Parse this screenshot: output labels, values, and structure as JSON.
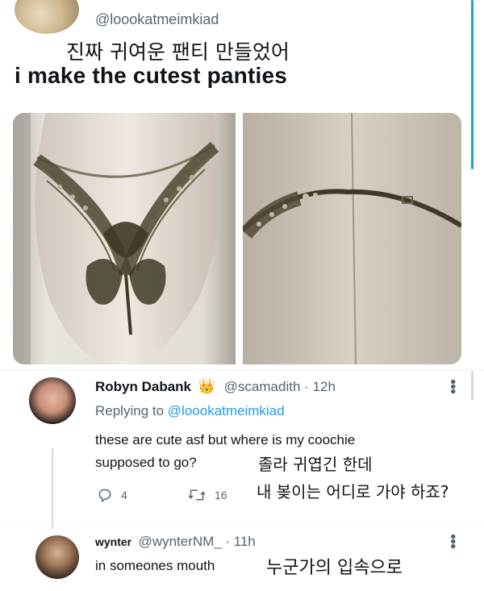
{
  "tweet": {
    "handle": "@loookatmeimkiad",
    "text_korean": "진짜 귀여운 팬티 만들었어",
    "text_english": "i make the cutest panties"
  },
  "reply1": {
    "name": "Robyn Dabank",
    "badge": "👑",
    "handle": "@scamadith",
    "time": "· 12h",
    "replying_prefix": "Replying to",
    "replying_handle": "@loookatmeimkiad",
    "text_line1": "these are cute asf but where is my coochie",
    "text_line2": "supposed to go?",
    "korean_line1": "졸라 귀엽긴 한데",
    "korean_line2": "내 봊이는 어디로 가야 하죠?",
    "reply_count": "4",
    "retweet_count": "16"
  },
  "reply2": {
    "name": "wynter",
    "handle": "@wynterNM_",
    "time": "· 11h",
    "text": "in someones mouth",
    "korean": "누군가의 입속으로"
  },
  "colors": {
    "accent": "#1d9bf0",
    "secondary_text": "#536471",
    "primary_text": "#0f1419"
  },
  "icons": [
    "more-icon",
    "reply-icon",
    "retweet-icon",
    "crown-badge-icon"
  ]
}
